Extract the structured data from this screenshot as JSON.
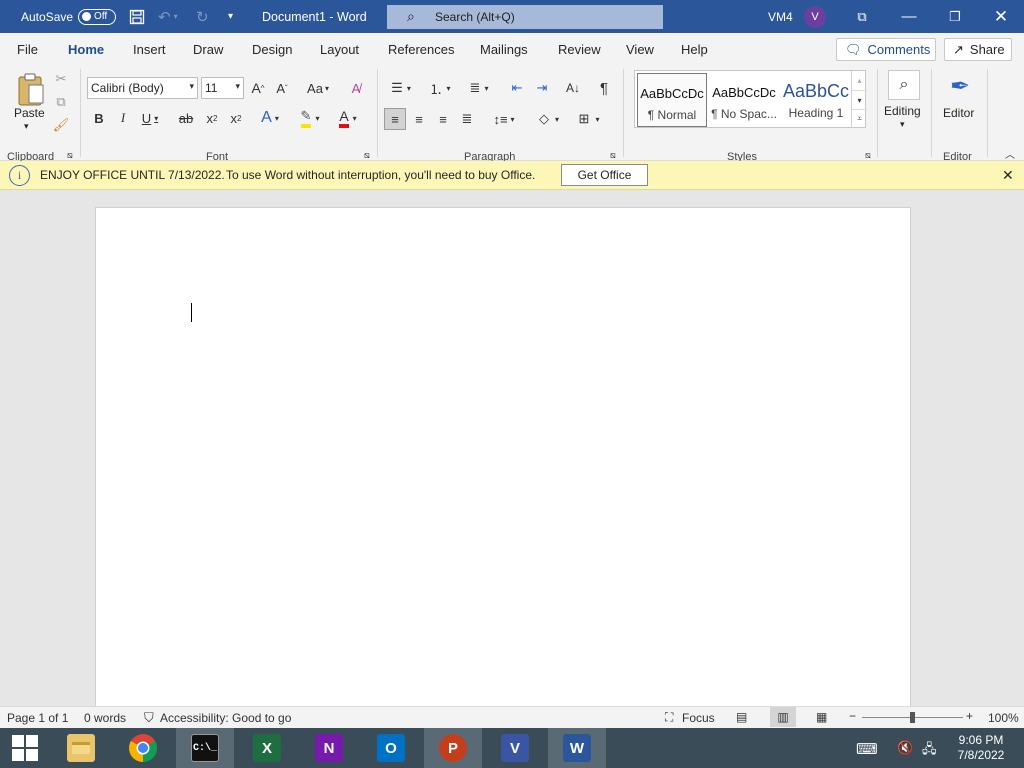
{
  "title": {
    "autosave_label": "AutoSave",
    "autosave_state": "Off",
    "doc_title": "Document1  -  Word",
    "search_placeholder": "Search (Alt+Q)",
    "user_initials_label": "VM4",
    "avatar_letter": "V"
  },
  "menu": {
    "tabs": [
      "File",
      "Home",
      "Insert",
      "Draw",
      "Design",
      "Layout",
      "References",
      "Mailings",
      "Review",
      "View",
      "Help"
    ],
    "active_tab": "Home",
    "comments": "Comments",
    "share": "Share"
  },
  "ribbon": {
    "clipboard": {
      "paste": "Paste",
      "group": "Clipboard"
    },
    "font": {
      "name": "Calibri (Body)",
      "size": "11",
      "group": "Font",
      "change_case": "Aa"
    },
    "paragraph": {
      "group": "Paragraph"
    },
    "styles": {
      "group": "Styles",
      "items": [
        {
          "preview": "AaBbCcDc",
          "name": "¶ Normal"
        },
        {
          "preview": "AaBbCcDc",
          "name": "¶ No Spac..."
        },
        {
          "preview": "AaBbCc",
          "name": "Heading 1"
        }
      ]
    },
    "editing": {
      "label": "Editing"
    },
    "editor": {
      "label": "Editor",
      "group": "Editor"
    }
  },
  "infobar": {
    "headline": "ENJOY OFFICE UNTIL 7/13/2022.",
    "message": "To use Word without interruption, you'll need to buy Office.",
    "button": "Get Office"
  },
  "status": {
    "page": "Page 1 of 1",
    "words": "0 words",
    "accessibility": "Accessibility: Good to go",
    "focus": "Focus",
    "zoom": "100%"
  },
  "taskbar": {
    "time": "9:06 PM",
    "date": "7/8/2022",
    "apps": [
      "file-explorer",
      "chrome",
      "terminal",
      "excel",
      "onenote",
      "outlook",
      "powerpoint",
      "visio",
      "word"
    ]
  },
  "colors": {
    "word_blue": "#2b579a",
    "infobar_yellow": "#fcf7b6",
    "taskbar": "#3a4c57"
  }
}
